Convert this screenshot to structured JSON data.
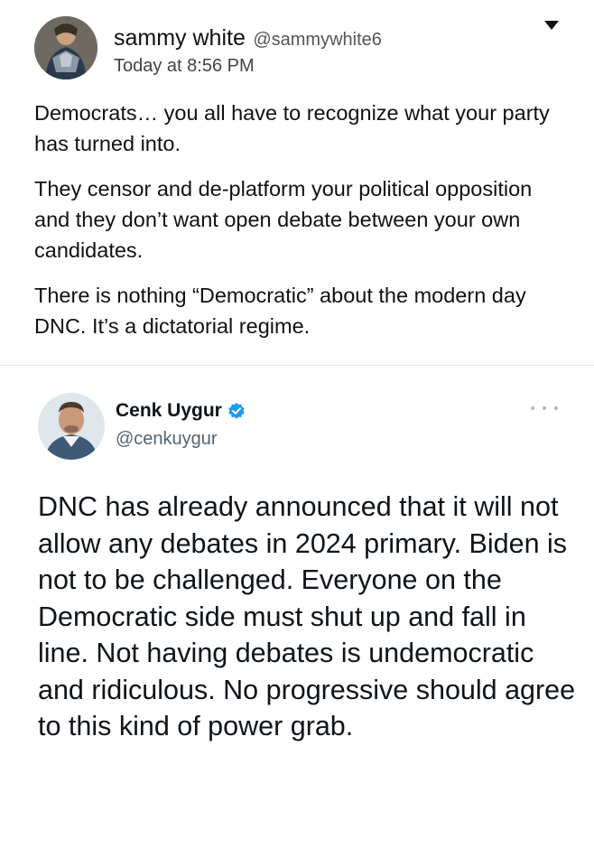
{
  "post": {
    "author_name": "sammy white",
    "author_handle": "@sammywhite6",
    "timestamp": "Today at 8:56 PM",
    "menu_icon": "caret-down-icon",
    "paragraphs": [
      "Democrats… you all have to recognize what your party has turned into.",
      "They censor and de-platform your political opposition and they don’t want open debate between your own candidates.",
      "There is nothing “Democratic” about the modern day DNC. It’s a dictatorial regime."
    ]
  },
  "quoted_tweet": {
    "author_name": "Cenk Uygur",
    "author_handle": "@cenkuygur",
    "verified_icon": "verified-badge-icon",
    "more_icon": "more-options-icon",
    "verified_color": "#1d9bf0",
    "text": "DNC has already announced that it will not allow any debates in 2024 primary. Biden is not to be challenged. Everyone on the Democratic side must shut up and fall in line. Not having debates is undemocratic and ridiculous. No progressive should agree to this kind of power grab."
  }
}
